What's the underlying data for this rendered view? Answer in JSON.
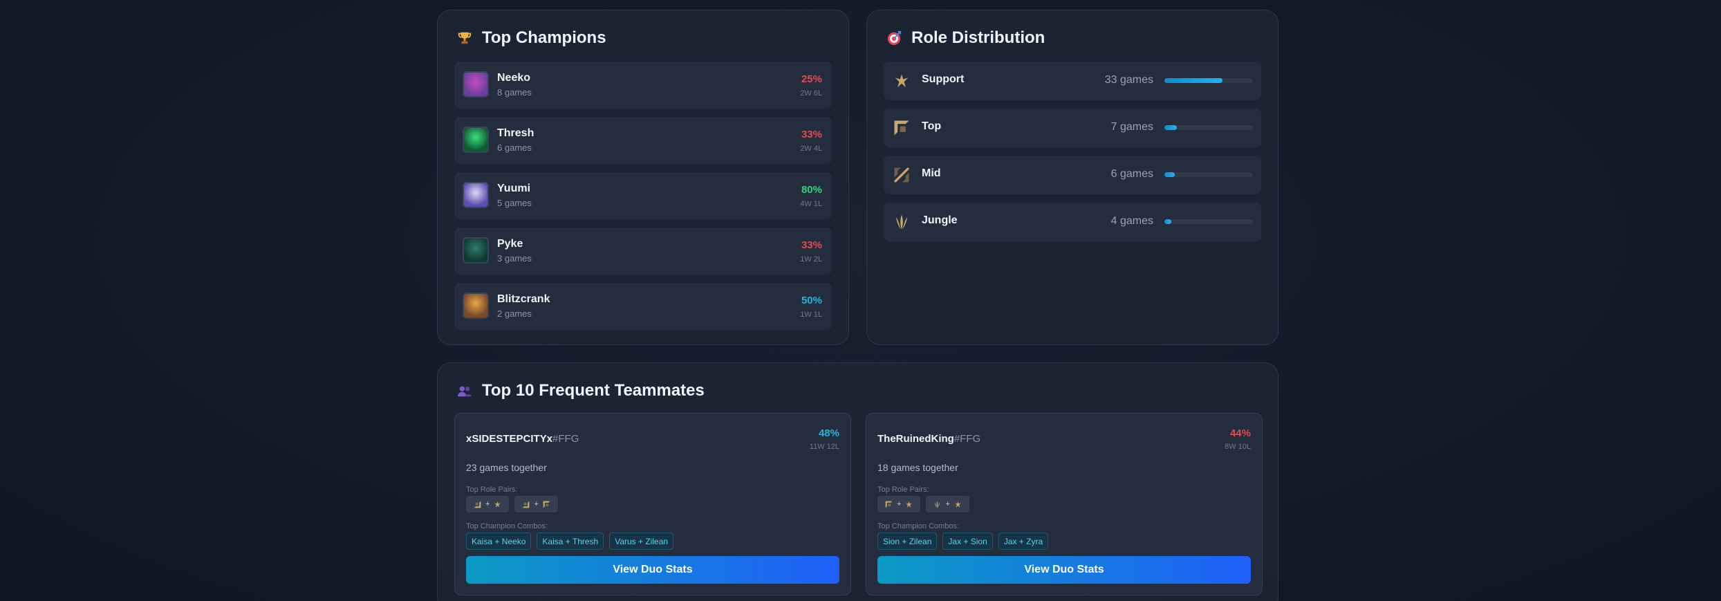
{
  "champions": {
    "title": "Top Champions",
    "items": [
      {
        "name": "Neeko",
        "games": "8 games",
        "winrate": "25%",
        "record": "2W 6L",
        "wr_color": "red",
        "avatar": [
          "#6b3fa0",
          "#c24fbd"
        ]
      },
      {
        "name": "Thresh",
        "games": "6 games",
        "winrate": "33%",
        "record": "2W 4L",
        "wr_color": "red",
        "avatar": [
          "#0d5b35",
          "#3ee07a"
        ]
      },
      {
        "name": "Yuumi",
        "games": "5 games",
        "winrate": "80%",
        "record": "4W 1L",
        "wr_color": "green",
        "avatar": [
          "#5a4fb0",
          "#e2d6f5"
        ]
      },
      {
        "name": "Pyke",
        "games": "3 games",
        "winrate": "33%",
        "record": "1W 2L",
        "wr_color": "red",
        "avatar": [
          "#0f3a34",
          "#2f7d6b"
        ]
      },
      {
        "name": "Blitzcrank",
        "games": "2 games",
        "winrate": "50%",
        "record": "1W 1L",
        "wr_color": "cyan",
        "avatar": [
          "#7a4a2a",
          "#e9a64a"
        ]
      }
    ]
  },
  "roles": {
    "title": "Role Distribution",
    "items": [
      {
        "name": "Support",
        "games": "33 games",
        "share": 0.66,
        "icon": "support-role-icon"
      },
      {
        "name": "Top",
        "games": "7 games",
        "share": 0.14,
        "icon": "top-role-icon"
      },
      {
        "name": "Mid",
        "games": "6 games",
        "share": 0.12,
        "icon": "mid-role-icon"
      },
      {
        "name": "Jungle",
        "games": "4 games",
        "share": 0.08,
        "icon": "jungle-role-icon"
      }
    ]
  },
  "teammates": {
    "title": "Top 10 Frequent Teammates",
    "role_pairs_label": "Top Role Pairs:",
    "combos_label": "Top Champion Combos:",
    "button_label": "View Duo Stats",
    "cards": [
      {
        "name": "xSIDESTEPCITYx",
        "tag": "#FFG",
        "winrate": "48%",
        "record": "11W 12L",
        "wr_color": "cyan",
        "together": "23 games together",
        "pairs": [
          [
            "bot",
            "support"
          ],
          [
            "bot",
            "top"
          ]
        ],
        "combos": [
          "Kaisa + Neeko",
          "Kaisa + Thresh",
          "Varus + Zilean"
        ]
      },
      {
        "name": "TheRuinedKing",
        "tag": "#FFG",
        "winrate": "44%",
        "record": "8W 10L",
        "wr_color": "red",
        "together": "18 games together",
        "pairs": [
          [
            "top",
            "support"
          ],
          [
            "jungle",
            "support"
          ]
        ],
        "combos": [
          "Sion + Zilean",
          "Jax + Sion",
          "Jax + Zyra"
        ]
      }
    ]
  },
  "colors": {
    "accent_cyan": "#25b6de",
    "win_green": "#2ed47a",
    "loss_red": "#e34b55",
    "role_gold": "#c9a86a"
  }
}
